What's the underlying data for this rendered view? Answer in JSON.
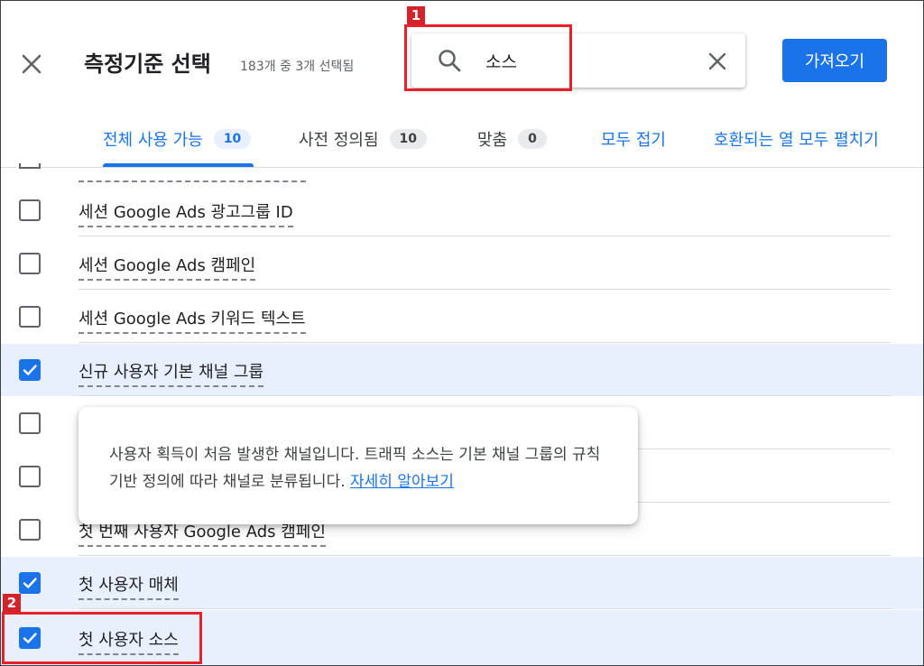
{
  "header": {
    "title": "측정기준 선택",
    "subtitle": "183개 중 3개 선택됨",
    "import_button": "가져오기"
  },
  "search": {
    "value": "소스"
  },
  "tabs": [
    {
      "label": "전체 사용 가능",
      "count": "10"
    },
    {
      "label": "사전 정의됨",
      "count": "10"
    },
    {
      "label": "맞춤",
      "count": "0"
    }
  ],
  "links": {
    "collapse_all": "모두 접기",
    "expand_all": "호환되는 열 모두 펼치기"
  },
  "rows": [
    {
      "label": "세션 Google Ads 광고그룹 ID",
      "checked": false
    },
    {
      "label": "세션 Google Ads 캠페인",
      "checked": false
    },
    {
      "label": "세션 Google Ads 키워드 텍스트",
      "checked": false
    },
    {
      "label": "신규 사용자 기본 채널 그룹",
      "checked": true
    },
    {
      "label": "",
      "checked": false
    },
    {
      "label": "",
      "checked": false
    },
    {
      "label": "첫 번째 사용자 Google Ads 캠페인",
      "checked": false
    },
    {
      "label": "첫 사용자 매체",
      "checked": true
    },
    {
      "label": "첫 사용자 소스",
      "checked": true
    }
  ],
  "tooltip": {
    "text": "사용자 획득이 처음 발생한 채널입니다. 트래픽 소스는 기본 채널 그룹의 규칙 기반 정의에 따라 채널로 분류됩니다.",
    "link": "자세히 알아보기"
  },
  "annotations": {
    "tag1": "1",
    "tag2": "2",
    "color": "#e8202a"
  },
  "colors": {
    "accent": "#1a73e8",
    "selected_row": "#e8f0fe"
  }
}
